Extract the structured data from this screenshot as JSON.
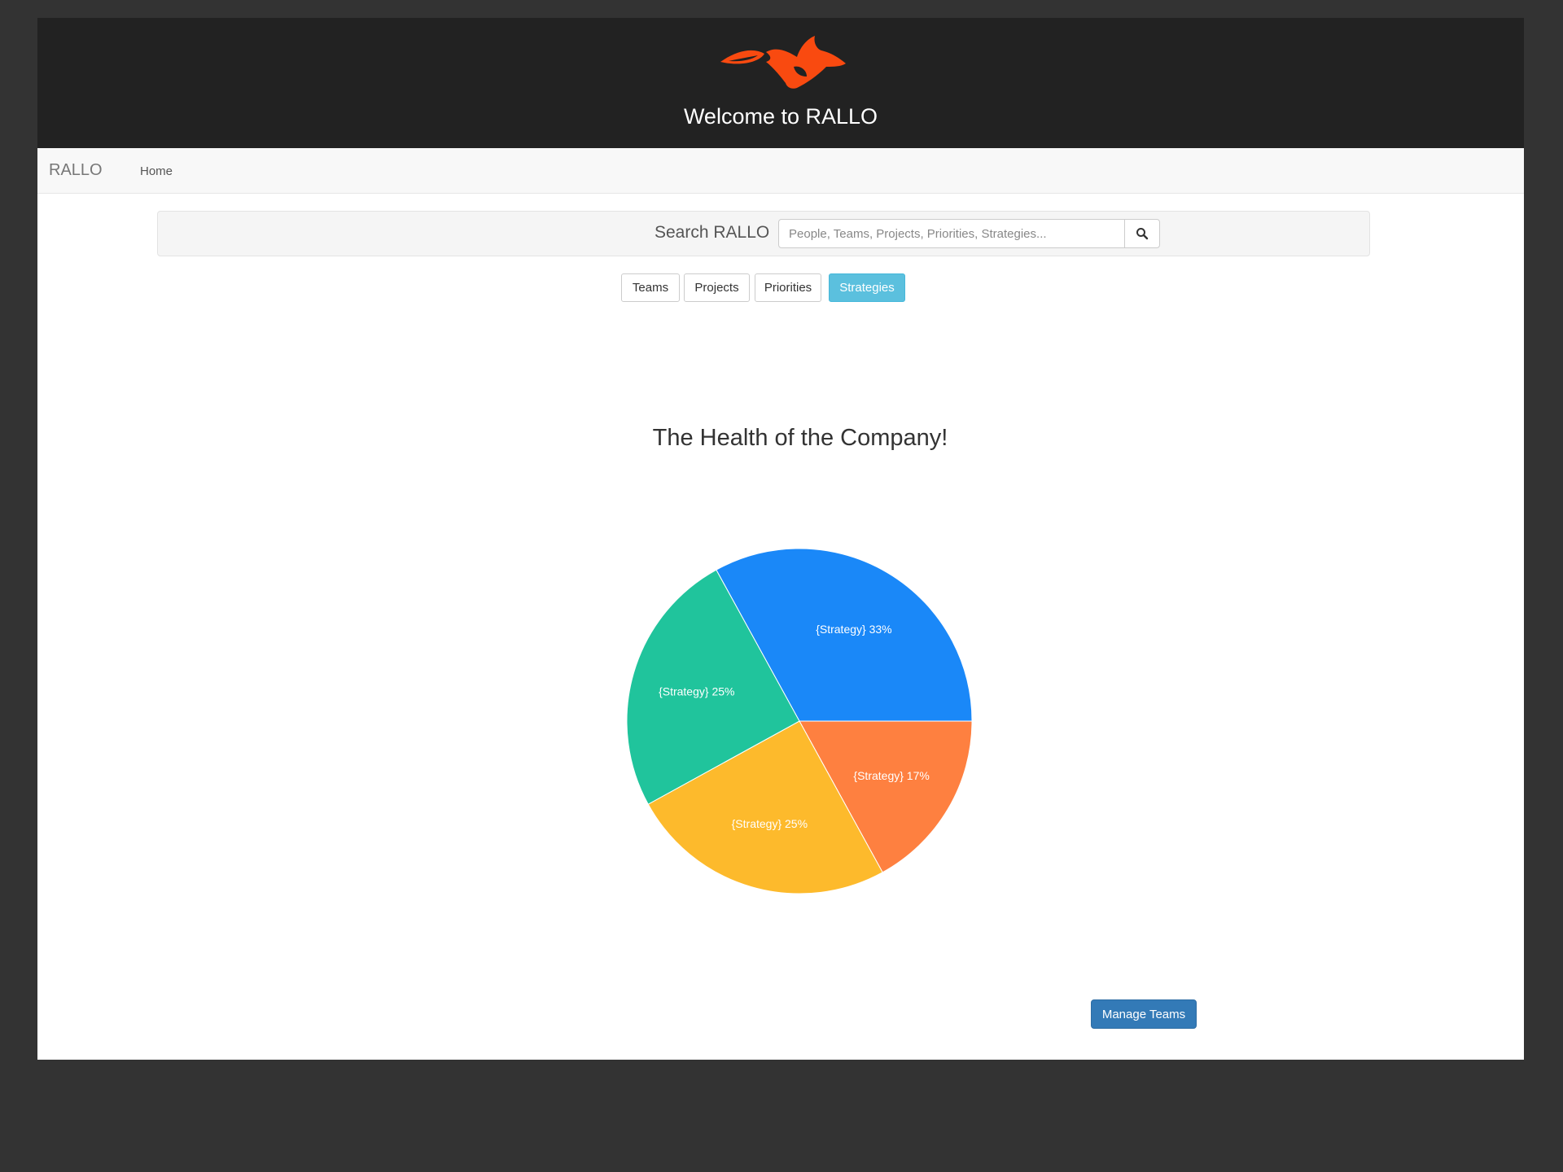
{
  "header": {
    "title": "Welcome to RALLO",
    "logo_icon": "fox-logo-icon",
    "logo_color": "#f94a10"
  },
  "navbar": {
    "brand": "RALLO",
    "items": [
      {
        "label": "Home"
      }
    ]
  },
  "search": {
    "label": "Search RALLO",
    "placeholder": "People, Teams, Projects, Priorities, Strategies...",
    "value": "",
    "button_icon": "search-icon"
  },
  "filters": [
    {
      "label": "Teams",
      "active": false
    },
    {
      "label": "Projects",
      "active": false
    },
    {
      "label": "Priorities",
      "active": false
    },
    {
      "label": "Strategies",
      "active": true
    }
  ],
  "chart_data": {
    "type": "pie",
    "title": "The Health of the Company!",
    "slices": [
      {
        "label": "{Strategy} 33%",
        "value": 33,
        "color": "#1a88f8"
      },
      {
        "label": "{Strategy} 17%",
        "value": 17,
        "color": "#fe8040"
      },
      {
        "label": "{Strategy} 25%",
        "value": 25,
        "color": "#fdba2c"
      },
      {
        "label": "{Strategy} 25%",
        "value": 25,
        "color": "#20c49c"
      }
    ]
  },
  "actions": {
    "manage_teams": "Manage Teams",
    "manage_color": "#337ab7"
  }
}
